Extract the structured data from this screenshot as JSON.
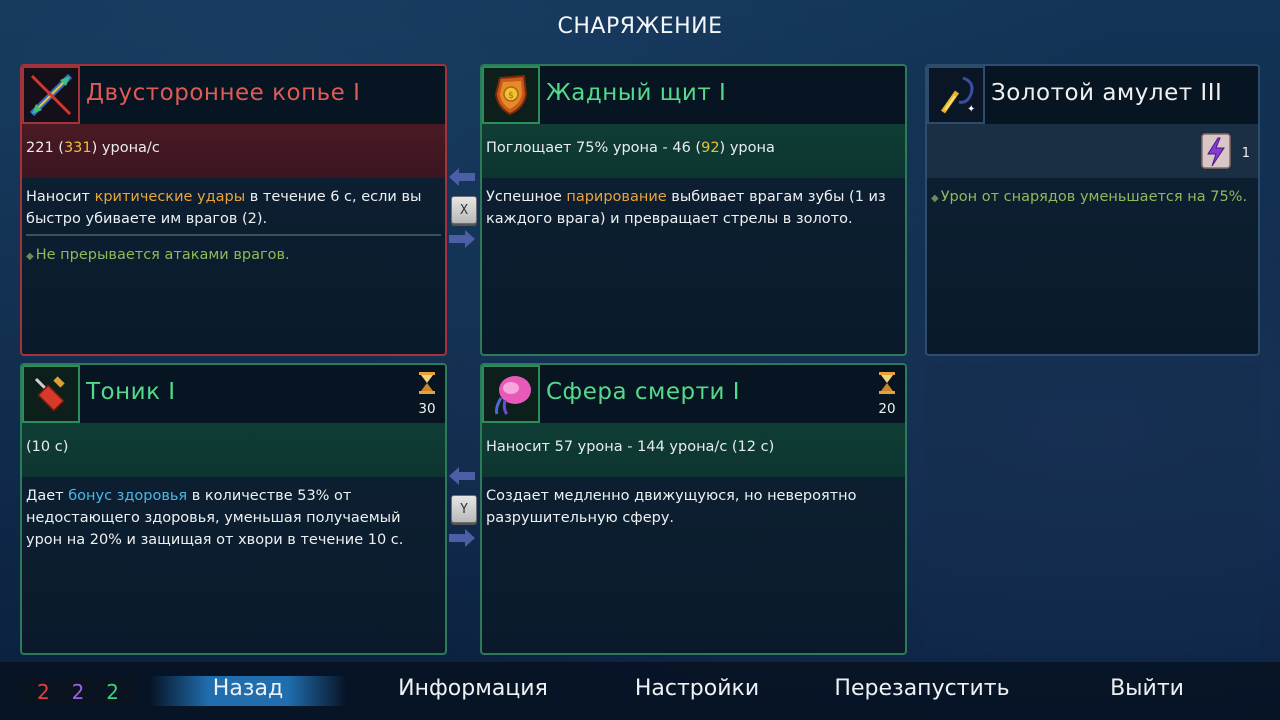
{
  "header": {
    "title": "СНАРЯЖЕНИЕ"
  },
  "cards": {
    "spear": {
      "name": "Двустороннее копье I",
      "stat_prefix": "221 (",
      "stat_highlight": "331",
      "stat_suffix": ") урона/с",
      "desc_prefix": "Наносит ",
      "desc_highlight": "критические удары",
      "desc_suffix": " в течение 6 с, если вы быстро убиваете им врагов (2).",
      "note": "Не прерывается атаками врагов."
    },
    "shield": {
      "name": "Жадный щит I",
      "stat_prefix": "Поглощает 75% урона - 46 (",
      "stat_highlight": "92",
      "stat_suffix": ") урона",
      "desc_prefix": "Успешное ",
      "desc_highlight": "парирование",
      "desc_suffix": " выбивает врагам зубы (1 из каждого врага) и превращает стрелы в золото."
    },
    "amulet": {
      "name": "Золотой амулет III",
      "scroll_count": "1",
      "note": "Урон от снарядов уменьшается на 75%."
    },
    "tonic": {
      "name": "Тоник I",
      "cooldown": "30",
      "stat": "(10 с)",
      "desc_prefix": "Дает ",
      "desc_highlight": "бонус здоровья",
      "desc_suffix": " в количестве 53% от недостающего здоровья, уменьшая получаемый урон на 20% и защищая от хвори в течение 10 с."
    },
    "sphere": {
      "name": "Сфера смерти I",
      "cooldown": "20",
      "stat": "Наносит 57 урона - 144 урона/с (12 с)",
      "desc": "Создает медленно движущуюся, но невероятно разрушительную сферу."
    }
  },
  "swap_keys": {
    "top": "X",
    "bottom": "Y"
  },
  "icons": {
    "spear": "double-spear-icon",
    "shield": "greedy-shield-icon",
    "amulet": "golden-amulet-icon",
    "scroll": "scroll-icon",
    "tonic": "tonic-icon",
    "sphere": "death-sphere-icon",
    "cooldown": "hourglass-icon",
    "arrow_left": "arrow-left-icon",
    "arrow_right": "arrow-right-icon"
  },
  "counters": {
    "red": "2",
    "purple": "2",
    "green": "2"
  },
  "menu": {
    "back": "Назад",
    "info": "Информация",
    "settings": "Настройки",
    "restart": "Перезапустить",
    "exit": "Выйти"
  },
  "colors": {
    "red_border": "#a3323a",
    "green_border": "#2b7a5a",
    "highlight_yellow": "#e6c23a",
    "highlight_orange": "#e9a43c",
    "highlight_cyan": "#4cb8e6",
    "note_green": "#8dbb5a"
  }
}
